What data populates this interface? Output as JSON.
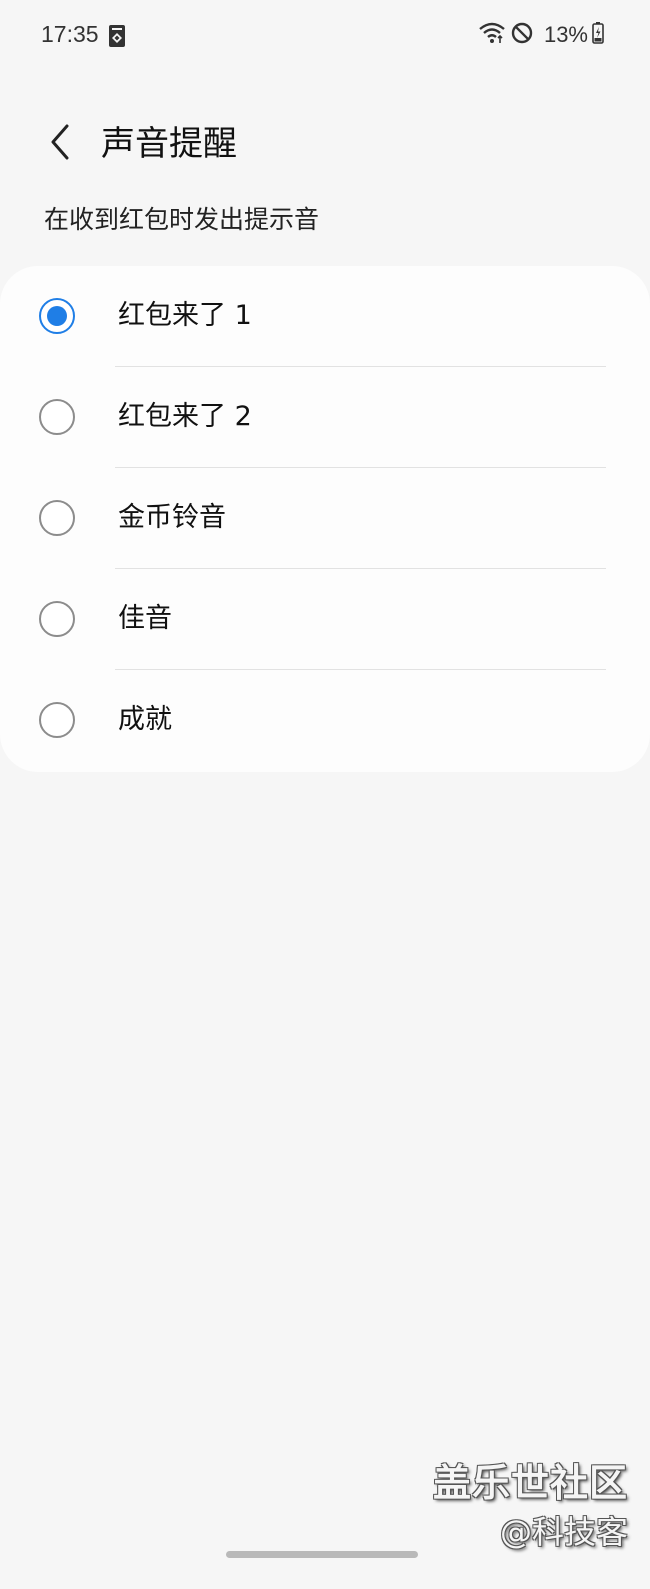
{
  "status_bar": {
    "time": "17:35",
    "notification_icon": "app-notification-icon",
    "wifi_icon": "wifi-icon",
    "dnd_icon": "do-not-disturb-icon",
    "battery_percent": "13%",
    "battery_icon": "battery-charging-icon"
  },
  "header": {
    "back_icon": "chevron-left-icon",
    "title": "声音提醒"
  },
  "subtitle": "在收到红包时发出提示音",
  "options": [
    {
      "label": "红包来了 1",
      "selected": true
    },
    {
      "label": "红包来了 2",
      "selected": false
    },
    {
      "label": "金币铃音",
      "selected": false
    },
    {
      "label": "佳音",
      "selected": false
    },
    {
      "label": "成就",
      "selected": false
    }
  ],
  "watermark": {
    "line1": "盖乐世社区",
    "line2": "@科技客"
  },
  "colors": {
    "accent": "#1f7ee6",
    "background": "#f6f6f6",
    "card": "#fdfdfd"
  }
}
